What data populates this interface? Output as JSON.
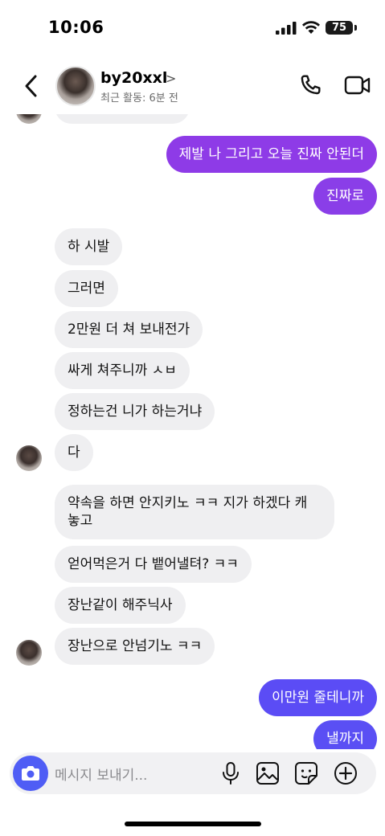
{
  "status_bar": {
    "time": "10:06",
    "battery": "75"
  },
  "header": {
    "username": "by20xxl",
    "activity": "최근 활동: 6분 전"
  },
  "messages": [
    {
      "dir": "out",
      "text": "제발 나 그리고 오늘 진짜 안된더"
    },
    {
      "dir": "out",
      "text": "진짜로"
    },
    {
      "dir": "in",
      "text": "하 시발"
    },
    {
      "dir": "in",
      "text": "그러면"
    },
    {
      "dir": "in",
      "text": "2만원 더 쳐 보내전가"
    },
    {
      "dir": "in",
      "text": "싸게 쳐주니까 ㅅㅂ"
    },
    {
      "dir": "in",
      "text": "정하는건 니가 하는거냐"
    },
    {
      "dir": "in",
      "text": "다"
    },
    {
      "dir": "in",
      "text": "약속을 하면 안지키노 ㅋㅋ 지가 하겠다 캐 놓고"
    },
    {
      "dir": "in",
      "text": "얻어먹은거 다 뱉어낼텨? ㅋㅋ"
    },
    {
      "dir": "in",
      "text": "장난같이 해주닉사"
    },
    {
      "dir": "in",
      "text": "장난으로 안넘기노 ㅋㅋ"
    },
    {
      "dir": "out",
      "text": "이만원 줄테니까"
    },
    {
      "dir": "out",
      "text": "낼까지"
    }
  ],
  "composer": {
    "placeholder": "메시지 보내기..."
  },
  "colors": {
    "out_purple": "#8b3ee6",
    "out_blue": "#5b4cf5",
    "incoming": "#efeff1",
    "camera": "#4f5df5"
  },
  "icons": [
    "back-chevron-icon",
    "call-icon",
    "video-icon",
    "camera-icon",
    "microphone-icon",
    "gallery-icon",
    "sticker-icon",
    "plus-icon"
  ]
}
